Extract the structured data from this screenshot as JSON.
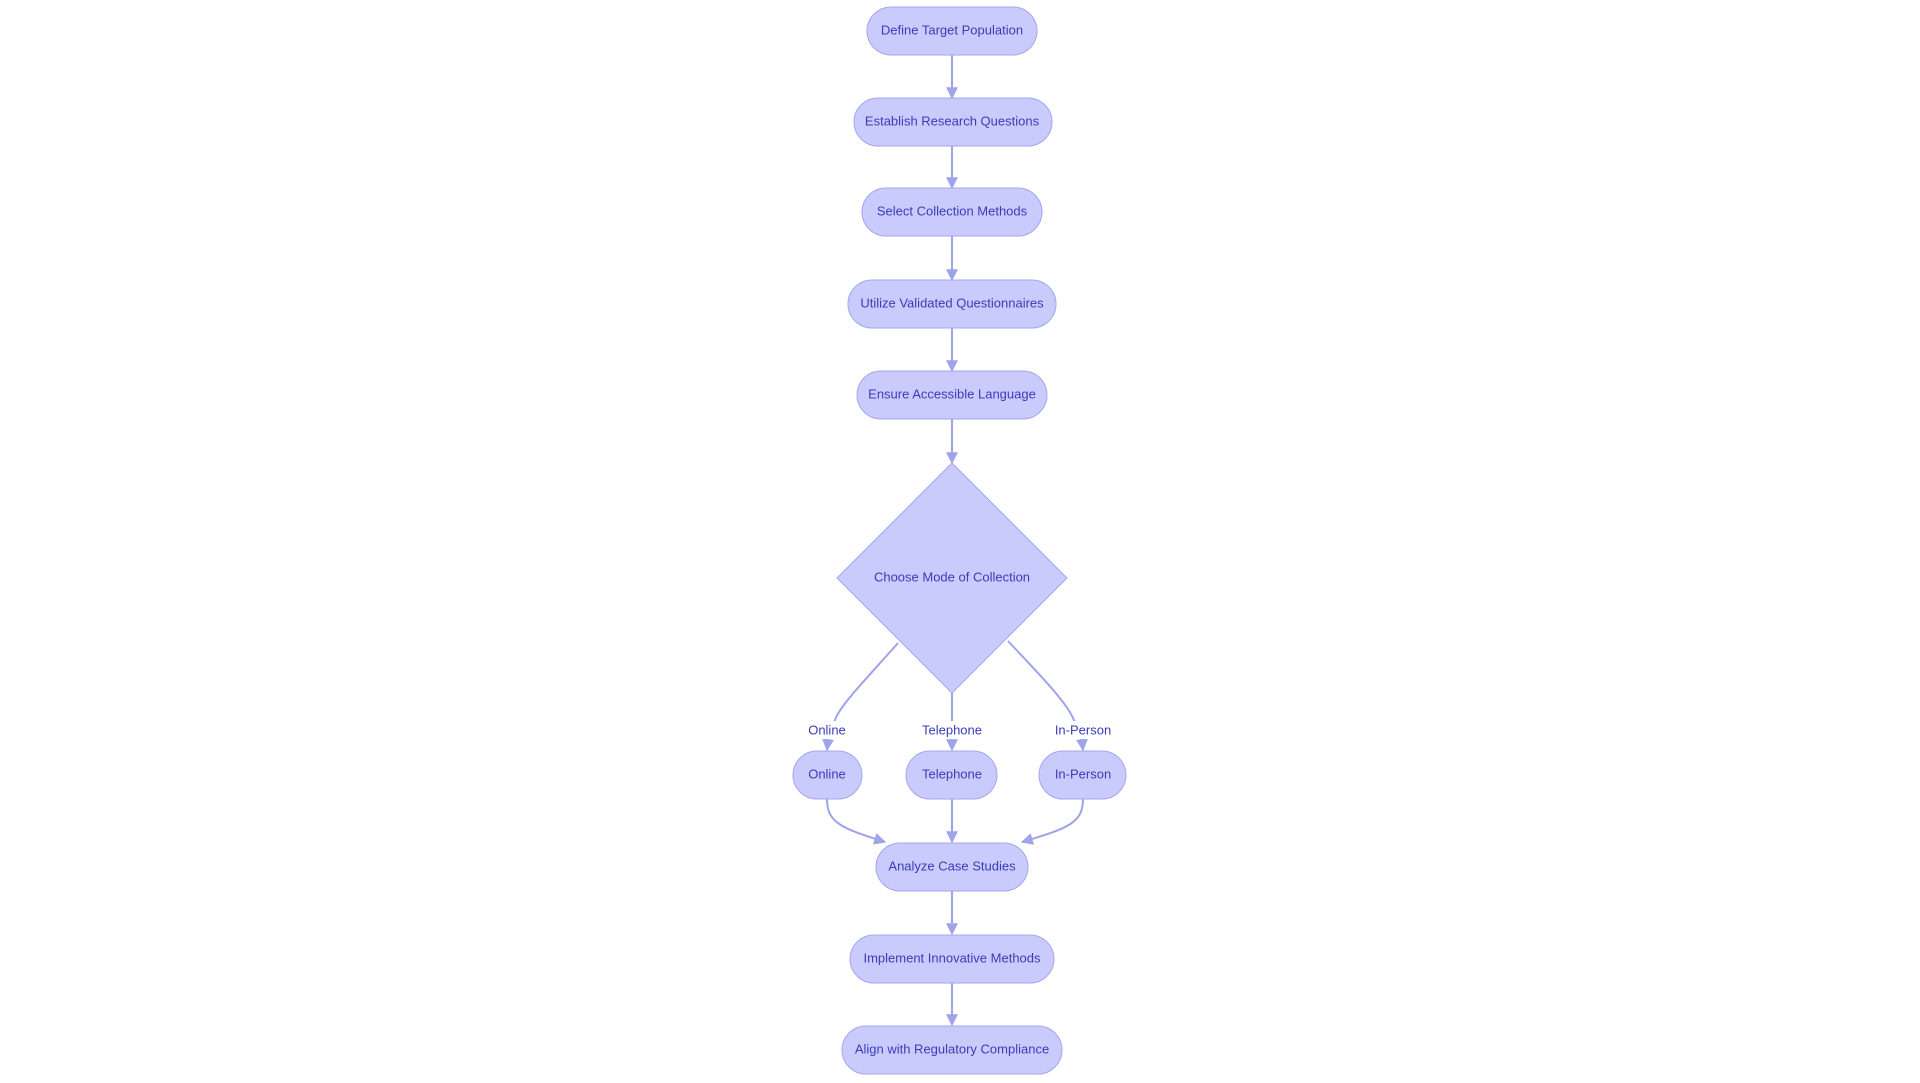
{
  "diagram": {
    "type": "flowchart",
    "colors": {
      "node_fill": "#c9cbfd",
      "node_stroke": "#a3a6ee",
      "text": "#3b3bb8",
      "edge": "#9fa3ea"
    },
    "nodes": {
      "define": "Define Target Population",
      "establish": "Establish Research Questions",
      "select": "Select Collection Methods",
      "utilize": "Utilize Validated Questionnaires",
      "ensure": "Ensure Accessible Language",
      "choose": "Choose Mode of Collection",
      "online": "Online",
      "telephone": "Telephone",
      "inperson": "In-Person",
      "analyze": "Analyze Case Studies",
      "implement": "Implement Innovative Methods",
      "align": "Align with Regulatory Compliance"
    },
    "edge_labels": {
      "online": "Online",
      "telephone": "Telephone",
      "inperson": "In-Person"
    }
  }
}
